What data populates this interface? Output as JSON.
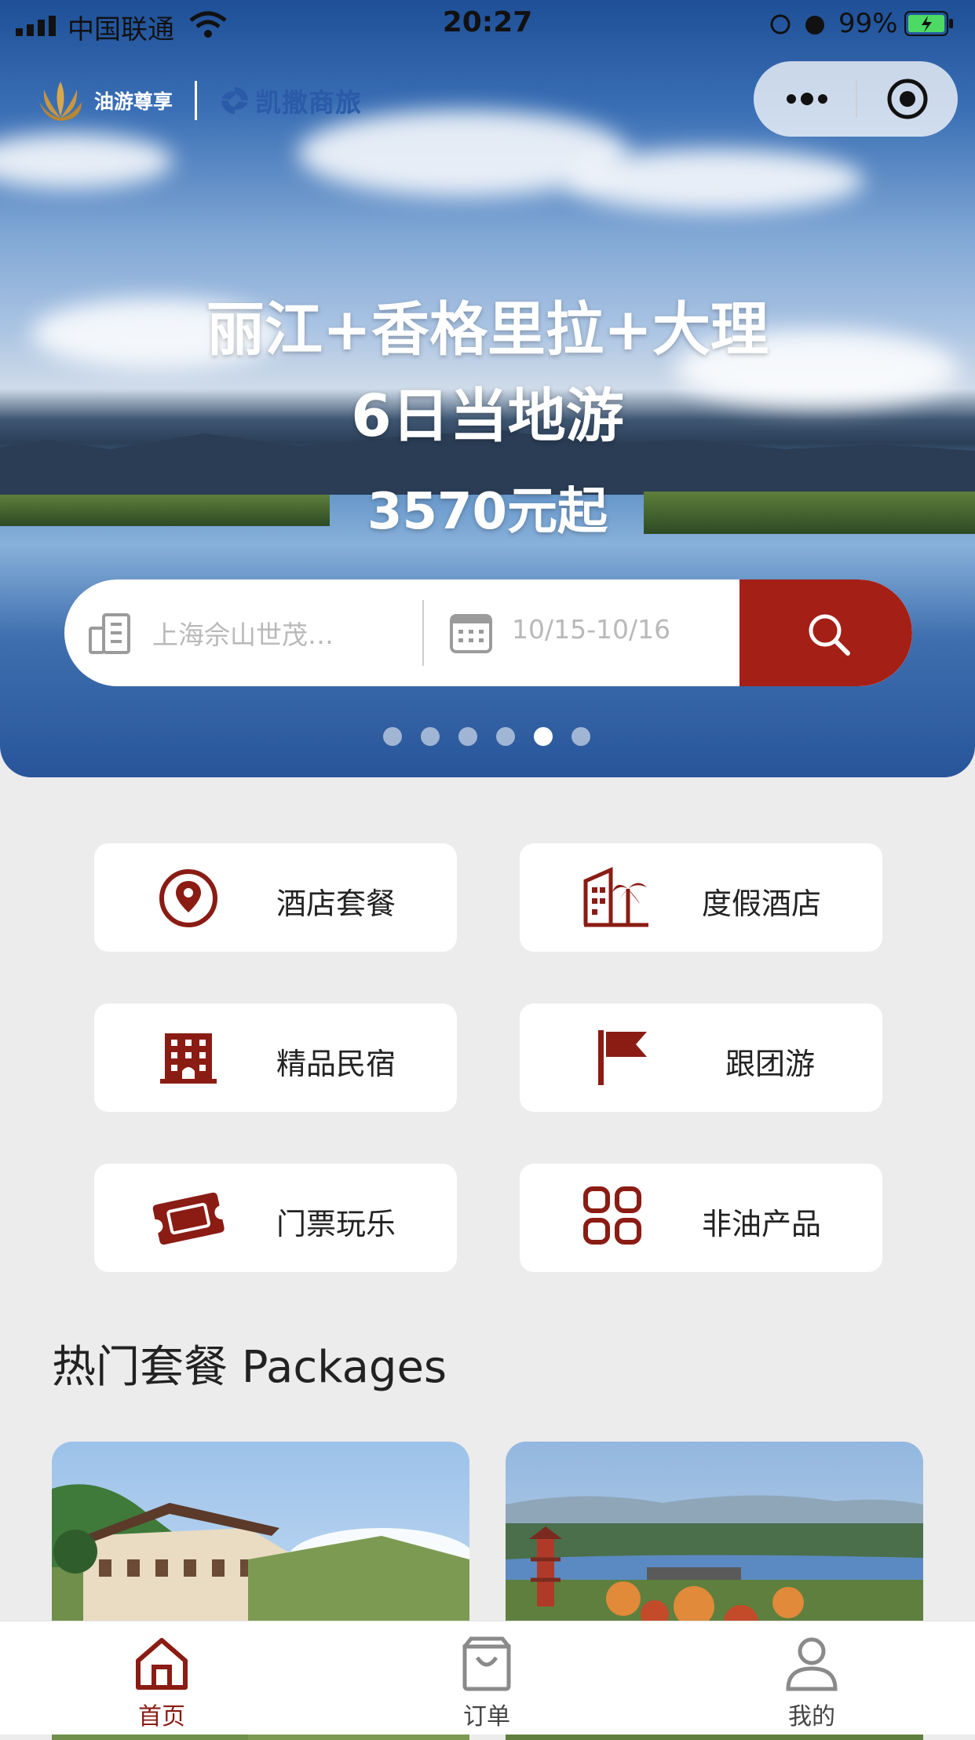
{
  "status_bar": {
    "carrier": "中国联通",
    "time": "20:27",
    "battery": "99%"
  },
  "brand": {
    "name1": "油游尊享",
    "name2": "凯撒商旅"
  },
  "banner": {
    "line1": "丽江+香格里拉+大理",
    "line2": "6日当地游",
    "line3": "3570元起",
    "slide_count": 6,
    "active_slide": 5
  },
  "search": {
    "hotel_placeholder": "上海佘山世茂…",
    "date_placeholder": "10/15-10/16"
  },
  "categories": [
    {
      "label": "酒店套餐",
      "icon": "location-pin-icon"
    },
    {
      "label": "度假酒店",
      "icon": "resort-palm-icon"
    },
    {
      "label": "精品民宿",
      "icon": "building-icon"
    },
    {
      "label": "跟团游",
      "icon": "flag-icon"
    },
    {
      "label": "门票玩乐",
      "icon": "ticket-icon"
    },
    {
      "label": "非油产品",
      "icon": "grid-apps-icon"
    }
  ],
  "section": {
    "title": "热门套餐 Packages"
  },
  "tabbar": [
    {
      "label": "首页",
      "icon": "home-icon",
      "active": true
    },
    {
      "label": "订单",
      "icon": "shopping-bag-icon",
      "active": false
    },
    {
      "label": "我的",
      "icon": "user-icon",
      "active": false
    }
  ],
  "colors": {
    "accent": "#a41f16",
    "icon": "#8a1c14",
    "inactive": "#8a8a8a"
  }
}
